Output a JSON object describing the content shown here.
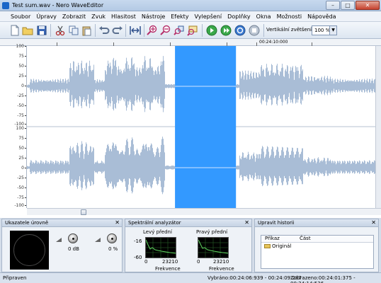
{
  "window": {
    "title": "Test sum.wav - Nero WaveEditor",
    "minimize": "–",
    "maximize": "□",
    "close": "✕"
  },
  "menu": [
    "Soubor",
    "Úpravy",
    "Zobrazit",
    "Zvuk",
    "Hlasitost",
    "Nástroje",
    "Efekty",
    "Vylepšení",
    "Doplňky",
    "Okna",
    "Možnosti",
    "Nápověda"
  ],
  "toolbar": {
    "icons": [
      "new-file-icon",
      "open-folder-icon",
      "save-disk-icon",
      "cut-scissors-icon",
      "copy-icon",
      "paste-icon",
      "undo-icon",
      "redo-icon",
      "fit-width-icon",
      "zoom-in-icon",
      "zoom-out-icon",
      "zoom-selection-icon",
      "zoom-full-icon",
      "play-icon",
      "play-selection-icon",
      "loop-icon",
      "stop-icon"
    ],
    "zoom_label": "Vertikální zvětšení:",
    "zoom_value": "100 %"
  },
  "editor": {
    "ruler_time": "00:24:10:000",
    "y_ticks_top": [
      "100",
      "75",
      "50",
      "25",
      "0",
      "-25",
      "-50",
      "-75",
      "-100"
    ],
    "y_ticks_bottom": [
      "100",
      "75",
      "50",
      "25",
      "0",
      "-25",
      "-50",
      "-75",
      "-100"
    ],
    "wave_color": "#a9bdd6",
    "selection_color": "#3399ff",
    "selection_start_fraction": 0.425,
    "selection_end_fraction": 0.6
  },
  "panes": {
    "levels": {
      "title": "Ukazatele úrovně",
      "gain_value": "0 dB",
      "pan_value": "0 %"
    },
    "spectrum": {
      "title": "Spektrální analyzátor",
      "left_label": "Levý přední",
      "right_label": "Pravý přední",
      "db_top": "-16",
      "db_bottom": "-60",
      "freq_min": "0",
      "freq_max": "23210",
      "freq_label": "Frekvence"
    },
    "history": {
      "title": "Upravit historii",
      "col_command": "Příkaz",
      "col_part": "Část",
      "rows": [
        "Originál"
      ]
    },
    "close_glyph": "✕"
  },
  "status": {
    "ready": "Připraven",
    "selected": "Vybráno:00:24:06:939 - 00:24:09:287",
    "displayed": "Zobrazeno:00:24:01:375 - 00:24:14:536"
  }
}
